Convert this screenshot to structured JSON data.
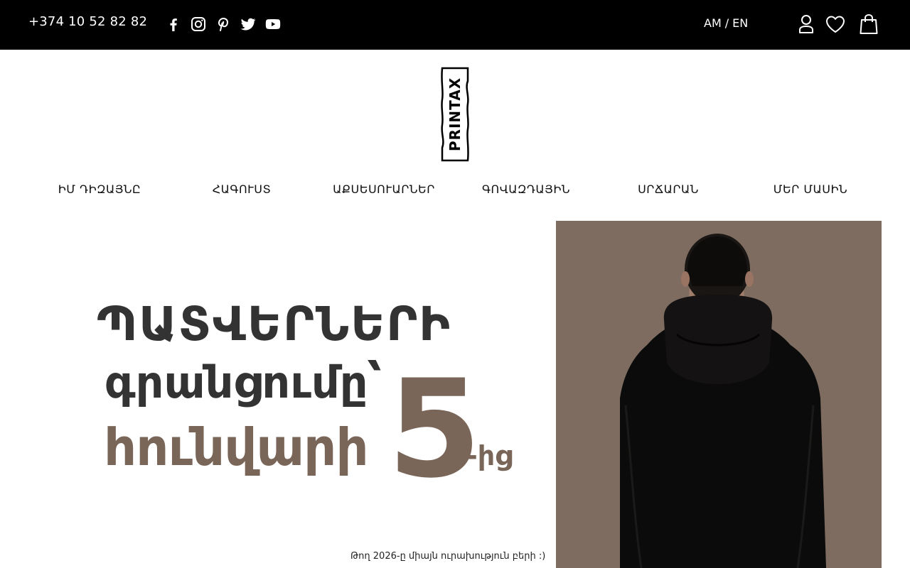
{
  "topbar": {
    "phone": "+374 10 52 82 82",
    "social_icons": [
      "facebook-icon",
      "instagram-icon",
      "pinterest-icon",
      "twitter-icon",
      "youtube-icon"
    ],
    "lang_am": "AM",
    "lang_separator": "/",
    "lang_en": "EN",
    "utility_icons": [
      "user-icon",
      "heart-icon",
      "shopping-bag-icon"
    ]
  },
  "logo": {
    "text": "PRINTAX"
  },
  "nav": {
    "items": [
      {
        "label": "ԻՄ ԴԻԶԱՅՆԸ"
      },
      {
        "label": "ՀԱԳՈՒՍՏ"
      },
      {
        "label": "ԱՔՍԵՍՈՒԱՐՆԵՐ"
      },
      {
        "label": "ԳՈՎԱԶԴԱՅԻՆ"
      },
      {
        "label": "ՍՐՃԱՐԱՆ"
      },
      {
        "label": "ՄԵՐ ՄԱՍԻՆ"
      }
    ]
  },
  "hero": {
    "line1": "ՊԱՏՎԵՐՆԵՐԻ",
    "line2": "գրանցումը՝",
    "line3": "հունվարի",
    "number": "5",
    "suffix": "-ից",
    "caption": "Թող 2026-ը միայն ուրախություն բերի :)"
  },
  "colors": {
    "topbar_bg": "#000000",
    "accent_brown": "#7a6658",
    "hero_bg": "#7e6c60",
    "text_dark": "#333333"
  }
}
